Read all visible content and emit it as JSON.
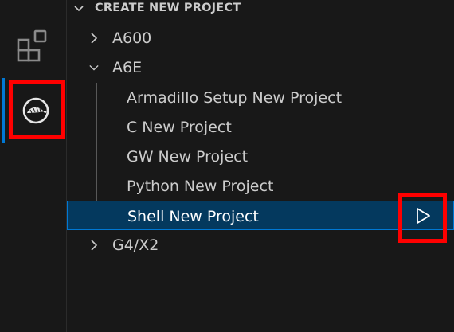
{
  "activity_bar": {
    "icons": [
      "extensions-icon",
      "armadillo-icon"
    ],
    "active_indicator_color": "#0078d4"
  },
  "sidebar": {
    "section_title": "CREATE NEW PROJECT",
    "groups": [
      {
        "label": "A600",
        "expanded": false
      },
      {
        "label": "A6E",
        "expanded": true,
        "items": [
          "Armadillo Setup New Project",
          "C New Project",
          "GW New Project",
          "Python New Project",
          "Shell New Project"
        ]
      },
      {
        "label": "G4/X2",
        "expanded": false
      }
    ],
    "selected_item": "Shell New Project",
    "selected_action": "play-icon"
  },
  "highlight_color": "#ff0000",
  "selection_color": "#04395e"
}
